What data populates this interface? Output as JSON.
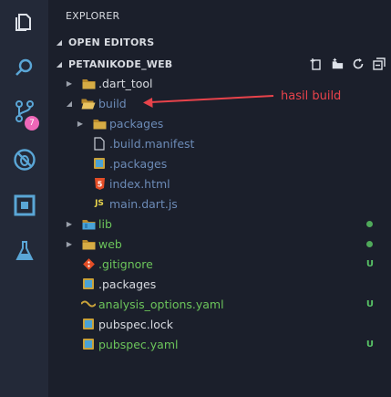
{
  "activity_bar": {
    "items": [
      {
        "name": "explorer-icon"
      },
      {
        "name": "search-icon"
      },
      {
        "name": "source-control-icon",
        "badge": "7"
      },
      {
        "name": "debug-icon"
      },
      {
        "name": "extensions-icon"
      },
      {
        "name": "test-flask-icon"
      }
    ]
  },
  "explorer": {
    "title": "EXPLORER",
    "open_editors": "OPEN EDITORS",
    "project": "PETANIKODE_WEB"
  },
  "tree": [
    {
      "label": ".dart_tool",
      "type": "folder",
      "expanded": false,
      "depth": 0,
      "color": "white"
    },
    {
      "label": "build",
      "type": "folder",
      "expanded": true,
      "depth": 0,
      "color": "dim"
    },
    {
      "label": "packages",
      "type": "folder",
      "expanded": false,
      "depth": 1,
      "color": "dim"
    },
    {
      "label": ".build.manifest",
      "type": "file",
      "depth": 1,
      "color": "dim"
    },
    {
      "label": ".packages",
      "type": "file",
      "depth": 1,
      "color": "dim"
    },
    {
      "label": "index.html",
      "type": "html",
      "depth": 1,
      "color": "dim"
    },
    {
      "label": "main.dart.js",
      "type": "js",
      "depth": 1,
      "color": "dim"
    },
    {
      "label": "lib",
      "type": "folder",
      "expanded": false,
      "depth": 0,
      "color": "green",
      "status": "dot"
    },
    {
      "label": "web",
      "type": "folder",
      "expanded": false,
      "depth": 0,
      "color": "green",
      "status": "dot"
    },
    {
      "label": ".gitignore",
      "type": "git",
      "depth": 0,
      "color": "green",
      "status": "U"
    },
    {
      "label": ".packages",
      "type": "file",
      "depth": 0,
      "color": "white"
    },
    {
      "label": "analysis_options.yaml",
      "type": "yaml",
      "depth": 0,
      "color": "green",
      "status": "U"
    },
    {
      "label": "pubspec.lock",
      "type": "file",
      "depth": 0,
      "color": "white"
    },
    {
      "label": "pubspec.yaml",
      "type": "file",
      "depth": 0,
      "color": "green",
      "status": "U"
    }
  ],
  "annotation": {
    "text": "hasil build",
    "color": "#e8434b"
  },
  "colors": {
    "activity_bg": "#232938",
    "sidebar_bg": "#1b1f2b",
    "badge": "#ee67b8",
    "git_added": "#57c165",
    "folder": "#c9a23a"
  }
}
